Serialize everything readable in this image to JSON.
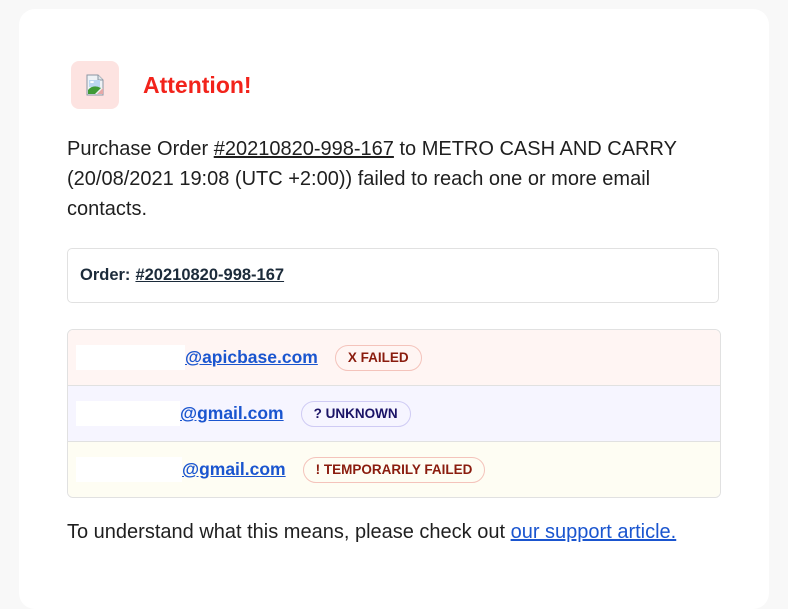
{
  "header": {
    "icon": "broken-image-icon",
    "title": "Attention!"
  },
  "intro": {
    "prefix": "Purchase Order ",
    "order_link": "#20210820-998-167",
    "suffix": " to METRO CASH AND CARRY (20/08/2021 19:08 (UTC +2:00)) failed to reach one or more email contacts."
  },
  "order": {
    "label": "Order:",
    "number": "#20210820-998-167"
  },
  "contacts": [
    {
      "email": "@apicbase.com",
      "status": "X FAILED",
      "status_type": "failed"
    },
    {
      "email": "@gmail.com",
      "status": "? UNKNOWN",
      "status_type": "unknown"
    },
    {
      "email": "@gmail.com",
      "status": "! TEMPORARILY FAILED",
      "status_type": "temporarily-failed"
    }
  ],
  "footer": {
    "text": "To understand what this means, please check out ",
    "link": "our support article."
  },
  "colors": {
    "title": "#f2231b",
    "link": "#1a55cf",
    "failed_bg": "#fff5f3",
    "unknown_bg": "#f6f5ff",
    "temp_bg": "#fefdf3"
  }
}
